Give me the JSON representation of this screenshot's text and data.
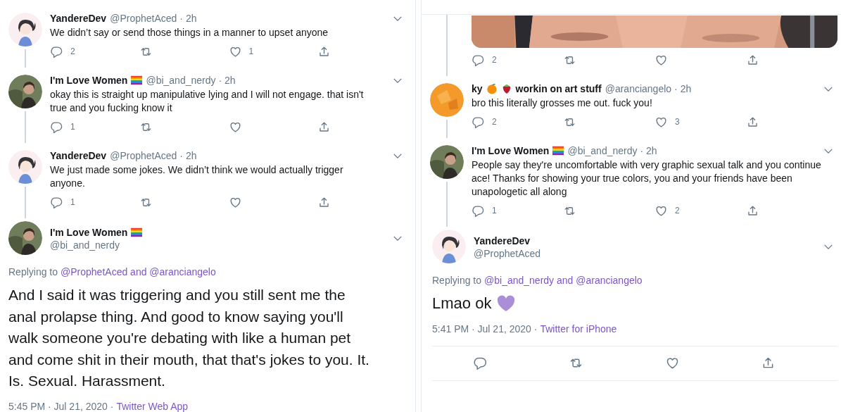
{
  "left": {
    "tweets": [
      {
        "avatar": {
          "kind": "picture"
        },
        "name": "YandereDev",
        "handle": "@ProphetAced",
        "time": "· 2h",
        "text": "We didn’t say or send those things in a manner to upset anyone",
        "thread_below": true,
        "actions": [
          {
            "kind": "reply",
            "count": "2"
          },
          {
            "kind": "retweet"
          },
          {
            "kind": "like",
            "count": "1"
          },
          {
            "kind": "share"
          }
        ]
      },
      {
        "avatar": {
          "kind": "picture"
        },
        "name": "I'm Love Women",
        "badges": [
          {
            "kind": "rainbow-flag"
          }
        ],
        "handle": "@bi_and_nerdy",
        "time": "· 2h",
        "text": "okay this is straight up manipulative lying and I will not engage. that isn't true and you fucking know it",
        "thread_below": true,
        "actions": [
          {
            "kind": "reply",
            "count": "1"
          },
          {
            "kind": "retweet"
          },
          {
            "kind": "like"
          },
          {
            "kind": "share"
          }
        ]
      },
      {
        "avatar": {
          "kind": "picture"
        },
        "name": "YandereDev",
        "handle": "@ProphetAced",
        "time": "· 2h",
        "text": "We just made some jokes. We didn’t think we would actually trigger anyone.",
        "thread_below": true,
        "actions": [
          {
            "kind": "reply",
            "count": "1"
          },
          {
            "kind": "retweet"
          },
          {
            "kind": "like"
          },
          {
            "kind": "share"
          }
        ]
      }
    ],
    "focus": {
      "avatar": {
        "kind": "picture"
      },
      "name": "I'm Love Women",
      "badges": [
        {
          "kind": "rainbow-flag"
        }
      ],
      "handle": "@bi_and_nerdy",
      "replying_to": "Replying to",
      "mentions": "@ProphetAced and @aranciangelo",
      "text": "And I said it was triggering and you still sent me the anal prolapse thing. And good to know saying you'll walk someone you're debating with like a human pet and come shit in their mouth, that that's jokes to you. It. Is. Sexual. Harassment.",
      "timestamp": "5:45 PM · Jul 21, 2020 ·",
      "source": "Twitter Web App"
    }
  },
  "right": {
    "media_tweet": {
      "media": {
        "kind": "picture"
      },
      "actions": [
        {
          "kind": "reply",
          "count": "2"
        },
        {
          "kind": "retweet"
        },
        {
          "kind": "like"
        },
        {
          "kind": "share"
        }
      ]
    },
    "tweets": [
      {
        "avatar": {
          "kind": "picture"
        },
        "name": "ky",
        "badges": [
          {
            "kind": "orange"
          },
          {
            "kind": "strawberry"
          }
        ],
        "name_after": "workin on art stuff",
        "handle": "@aranciangelo",
        "time": "· 2h",
        "text": "bro this literally grosses me out. fuck you!",
        "thread_below": true,
        "actions": [
          {
            "kind": "reply",
            "count": "2"
          },
          {
            "kind": "retweet"
          },
          {
            "kind": "like",
            "count": "3"
          },
          {
            "kind": "share"
          }
        ]
      },
      {
        "avatar": {
          "kind": "picture"
        },
        "name": "I'm Love Women",
        "badges": [
          {
            "kind": "rainbow-flag"
          }
        ],
        "handle": "@bi_and_nerdy",
        "time": "· 2h",
        "text": "People say they're uncomfortable with very graphic sexual talk and you continue ace! Thanks for showing your true colors, you and your friends have been unapologetic all along",
        "thread_below": true,
        "actions": [
          {
            "kind": "reply",
            "count": "1"
          },
          {
            "kind": "retweet"
          },
          {
            "kind": "like",
            "count": "2"
          },
          {
            "kind": "share"
          }
        ]
      }
    ],
    "focus": {
      "avatar": {
        "kind": "picture"
      },
      "name": "YandereDev",
      "handle": "@ProphetAced",
      "replying_to": "Replying to",
      "mentions": "@bi_and_nerdy and @aranciangelo",
      "text": "Lmao ok",
      "text_badges": [
        {
          "kind": "purple-heart"
        }
      ],
      "timestamp": "5:41 PM · Jul 21, 2020 ·",
      "source": "Twitter for iPhone",
      "actions": [
        {
          "kind": "reply"
        },
        {
          "kind": "retweet"
        },
        {
          "kind": "like"
        },
        {
          "kind": "share"
        }
      ]
    }
  }
}
